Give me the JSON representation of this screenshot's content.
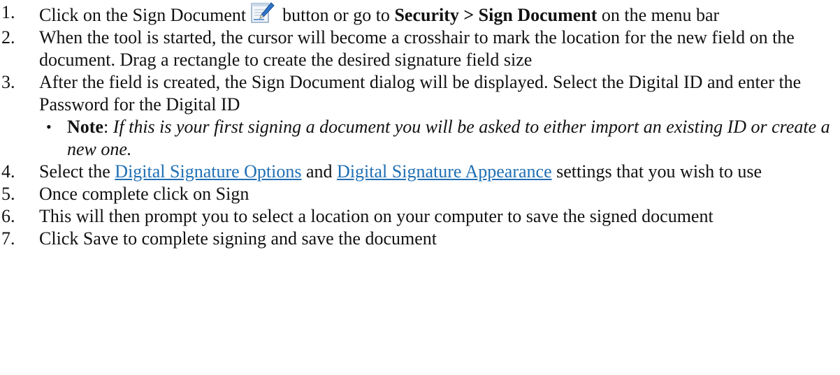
{
  "steps": [
    {
      "num": "1.",
      "before_icon": "Click on the Sign Document",
      "icon": "sign-document-icon",
      "after_icon": "button or go to ",
      "menu_path": "Security > Sign Document",
      "after_menu": " on the menu bar"
    },
    {
      "num": "2.",
      "text": "When the tool is started, the cursor will become a crosshair to mark the location for the new field on the document.  Drag a rectangle to create the desired signature field size"
    },
    {
      "num": "3.",
      "text": "After the field is created, the Sign Document dialog will be displayed. Select the Digital ID and enter the Password for the Digital ID",
      "note": {
        "label": "Note",
        "sep": ": ",
        "text": "If this is your first signing a document you will be asked to either import an existing ID or create a new one."
      }
    },
    {
      "num": "4.",
      "prefix": "Select the ",
      "link1": "Digital Signature Options",
      "middle": " and ",
      "link2": "Digital Signature Appearance",
      "suffix": " settings that you wish to use"
    },
    {
      "num": "5.",
      "text": "Once complete click on Sign"
    },
    {
      "num": "6.",
      "text": "This will then prompt you to select a location on your computer to save the signed document"
    },
    {
      "num": "7.",
      "text": "Click Save to complete signing and save the document"
    }
  ],
  "colors": {
    "link": "#1f6fb4",
    "text": "#111111"
  }
}
